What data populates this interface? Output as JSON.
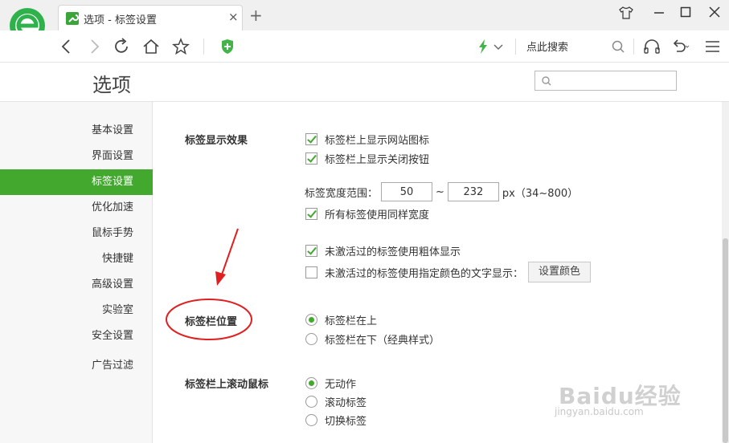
{
  "browser": {
    "tab_title": "选项 - 标签设置",
    "tab_close": "×",
    "new_tab": "+",
    "search_label": "点此搜索"
  },
  "page": {
    "title": "选项",
    "search_placeholder": ""
  },
  "sidebar": {
    "items": [
      {
        "label": "基本设置",
        "active": false
      },
      {
        "label": "界面设置",
        "active": false
      },
      {
        "label": "标签设置",
        "active": true
      },
      {
        "label": "优化加速",
        "active": false
      },
      {
        "label": "鼠标手势",
        "active": false
      },
      {
        "label": "快捷键",
        "active": false
      },
      {
        "label": "高级设置",
        "active": false
      },
      {
        "label": "实验室",
        "active": false
      },
      {
        "label": "安全设置",
        "active": false
      },
      {
        "label": "广告过滤",
        "active": false
      }
    ]
  },
  "tab_display": {
    "section_label": "标签显示效果",
    "show_site_icon": {
      "label": "标签栏上显示网站图标",
      "checked": true
    },
    "show_close_button": {
      "label": "标签栏上显示关闭按钮",
      "checked": true
    },
    "width_range_label": "标签宽度范围：",
    "width_min": "50",
    "width_sep": "~",
    "width_max": "232",
    "width_unit": "px（34~800）",
    "same_width": {
      "label": "所有标签使用同样宽度",
      "checked": true
    },
    "inactive_bold": {
      "label": "未激活过的标签使用粗体显示",
      "checked": true
    },
    "inactive_color": {
      "label": "未激活过的标签使用指定颜色的文字显示：",
      "checked": false
    },
    "set_color_button": "设置颜色"
  },
  "tab_position": {
    "section_label": "标签栏位置",
    "options": [
      {
        "label": "标签栏在上",
        "selected": true
      },
      {
        "label": "标签栏在下（经典样式）",
        "selected": false
      }
    ]
  },
  "scroll_action": {
    "section_label": "标签栏上滚动鼠标",
    "options": [
      {
        "label": "无动作",
        "selected": true
      },
      {
        "label": "滚动标签",
        "selected": false
      },
      {
        "label": "切换标签",
        "selected": false
      }
    ]
  },
  "watermark": {
    "main": "Baidu经验",
    "sub": "jingyan.baidu.com"
  },
  "colors": {
    "accent": "#43a92e",
    "annotation": "#e02020"
  }
}
